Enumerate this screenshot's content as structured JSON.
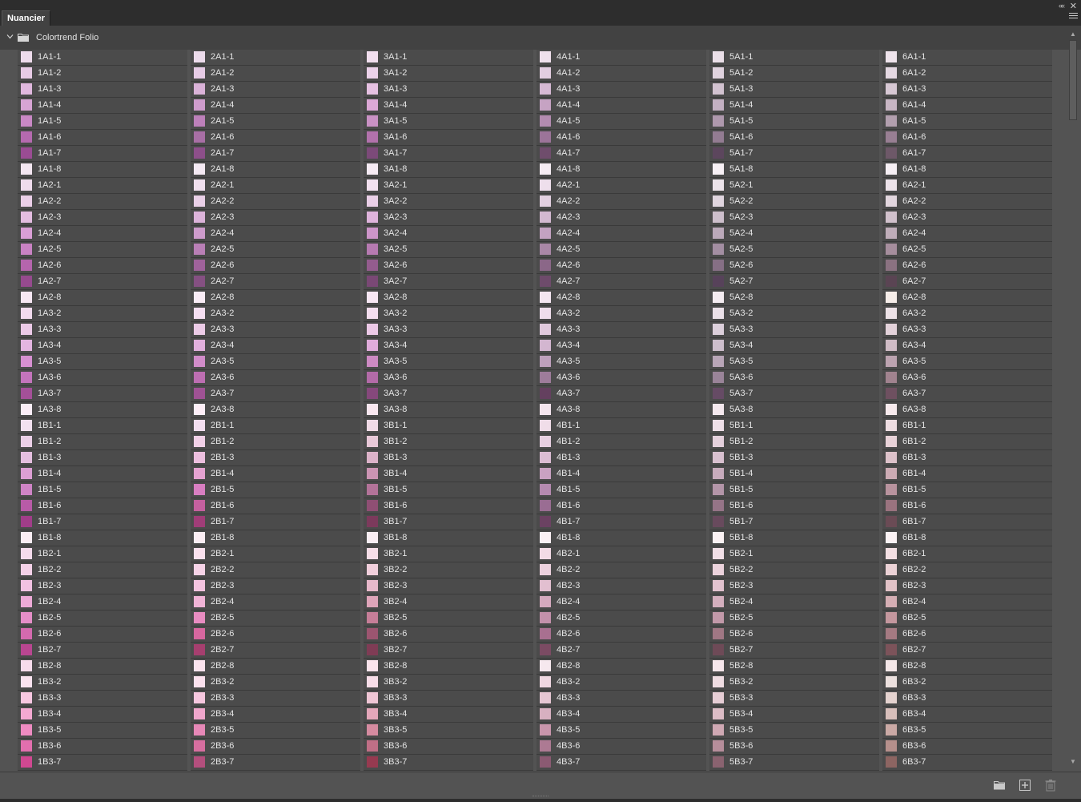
{
  "panel": {
    "tab_label": "Nuancier",
    "collapse_glyph": "««",
    "close_glyph": "✕",
    "menu_icon": "panel-menu-icon"
  },
  "group": {
    "label": "Colortrend Folio",
    "expanded": true,
    "icon": "folder-icon"
  },
  "swatch_labels": [
    [
      "1A1-1",
      "1A1-2",
      "1A1-3",
      "1A1-4",
      "1A1-5",
      "1A1-6",
      "1A1-7",
      "1A1-8",
      "1A2-1",
      "1A2-2",
      "1A2-3",
      "1A2-4",
      "1A2-5",
      "1A2-6",
      "1A2-7",
      "1A2-8",
      "1A3-2",
      "1A3-3",
      "1A3-4",
      "1A3-5",
      "1A3-6",
      "1A3-7",
      "1A3-8",
      "1B1-1",
      "1B1-2",
      "1B1-3",
      "1B1-4",
      "1B1-5",
      "1B1-6",
      "1B1-7",
      "1B1-8",
      "1B2-1",
      "1B2-2",
      "1B2-3",
      "1B2-4",
      "1B2-5",
      "1B2-6",
      "1B2-7",
      "1B2-8",
      "1B3-2",
      "1B3-3",
      "1B3-4",
      "1B3-5",
      "1B3-6",
      "1B3-7"
    ],
    [
      "2A1-1",
      "2A1-2",
      "2A1-3",
      "2A1-4",
      "2A1-5",
      "2A1-6",
      "2A1-7",
      "2A1-8",
      "2A2-1",
      "2A2-2",
      "2A2-3",
      "2A2-4",
      "2A2-5",
      "2A2-6",
      "2A2-7",
      "2A2-8",
      "2A3-2",
      "2A3-3",
      "2A3-4",
      "2A3-5",
      "2A3-6",
      "2A3-7",
      "2A3-8",
      "2B1-1",
      "2B1-2",
      "2B1-3",
      "2B1-4",
      "2B1-5",
      "2B1-6",
      "2B1-7",
      "2B1-8",
      "2B2-1",
      "2B2-2",
      "2B2-3",
      "2B2-4",
      "2B2-5",
      "2B2-6",
      "2B2-7",
      "2B2-8",
      "2B3-2",
      "2B3-3",
      "2B3-4",
      "2B3-5",
      "2B3-6",
      "2B3-7"
    ],
    [
      "3A1-1",
      "3A1-2",
      "3A1-3",
      "3A1-4",
      "3A1-5",
      "3A1-6",
      "3A1-7",
      "3A1-8",
      "3A2-1",
      "3A2-2",
      "3A2-3",
      "3A2-4",
      "3A2-5",
      "3A2-6",
      "3A2-7",
      "3A2-8",
      "3A3-2",
      "3A3-3",
      "3A3-4",
      "3A3-5",
      "3A3-6",
      "3A3-7",
      "3A3-8",
      "3B1-1",
      "3B1-2",
      "3B1-3",
      "3B1-4",
      "3B1-5",
      "3B1-6",
      "3B1-7",
      "3B1-8",
      "3B2-1",
      "3B2-2",
      "3B2-3",
      "3B2-4",
      "3B2-5",
      "3B2-6",
      "3B2-7",
      "3B2-8",
      "3B3-2",
      "3B3-3",
      "3B3-4",
      "3B3-5",
      "3B3-6",
      "3B3-7"
    ],
    [
      "4A1-1",
      "4A1-2",
      "4A1-3",
      "4A1-4",
      "4A1-5",
      "4A1-6",
      "4A1-7",
      "4A1-8",
      "4A2-1",
      "4A2-2",
      "4A2-3",
      "4A2-4",
      "4A2-5",
      "4A2-6",
      "4A2-7",
      "4A2-8",
      "4A3-2",
      "4A3-3",
      "4A3-4",
      "4A3-5",
      "4A3-6",
      "4A3-7",
      "4A3-8",
      "4B1-1",
      "4B1-2",
      "4B1-3",
      "4B1-4",
      "4B1-5",
      "4B1-6",
      "4B1-7",
      "4B1-8",
      "4B2-1",
      "4B2-2",
      "4B2-3",
      "4B2-4",
      "4B2-5",
      "4B2-6",
      "4B2-7",
      "4B2-8",
      "4B3-2",
      "4B3-3",
      "4B3-4",
      "4B3-5",
      "4B3-6",
      "4B3-7"
    ],
    [
      "5A1-1",
      "5A1-2",
      "5A1-3",
      "5A1-4",
      "5A1-5",
      "5A1-6",
      "5A1-7",
      "5A1-8",
      "5A2-1",
      "5A2-2",
      "5A2-3",
      "5A2-4",
      "5A2-5",
      "5A2-6",
      "5A2-7",
      "5A2-8",
      "5A3-2",
      "5A3-3",
      "5A3-4",
      "5A3-5",
      "5A3-6",
      "5A3-7",
      "5A3-8",
      "5B1-1",
      "5B1-2",
      "5B1-3",
      "5B1-4",
      "5B1-5",
      "5B1-6",
      "5B1-7",
      "5B1-8",
      "5B2-1",
      "5B2-2",
      "5B2-3",
      "5B2-4",
      "5B2-5",
      "5B2-6",
      "5B2-7",
      "5B2-8",
      "5B3-2",
      "5B3-3",
      "5B3-4",
      "5B3-5",
      "5B3-6",
      "5B3-7"
    ],
    [
      "6A1-1",
      "6A1-2",
      "6A1-3",
      "6A1-4",
      "6A1-5",
      "6A1-6",
      "6A1-7",
      "6A1-8",
      "6A2-1",
      "6A2-2",
      "6A2-3",
      "6A2-4",
      "6A2-5",
      "6A2-6",
      "6A2-7",
      "6A2-8",
      "6A3-2",
      "6A3-3",
      "6A3-4",
      "6A3-5",
      "6A3-6",
      "6A3-7",
      "6A3-8",
      "6B1-1",
      "6B1-2",
      "6B1-3",
      "6B1-4",
      "6B1-5",
      "6B1-6",
      "6B1-7",
      "6B1-8",
      "6B2-1",
      "6B2-2",
      "6B2-3",
      "6B2-4",
      "6B2-5",
      "6B2-6",
      "6B2-7",
      "6B2-8",
      "6B3-2",
      "6B3-3",
      "6B3-4",
      "6B3-5",
      "6B3-6",
      "6B3-7"
    ]
  ],
  "swatch_colors": [
    [
      "#eedcec",
      "#e8cce6",
      "#e0b8de",
      "#d7a4d4",
      "#c988c5",
      "#b56aaf",
      "#9a4c93",
      "#f3e6f1",
      "#f0dced",
      "#ebcfe8",
      "#e4bde1",
      "#da9fd6",
      "#c982c3",
      "#b565ad",
      "#964a8e",
      "#f7e7f3",
      "#f2dbee",
      "#eccae8",
      "#e4b5e1",
      "#d790d1",
      "#c474bc",
      "#a45098",
      "#fbeef7",
      "#f3e1f0",
      "#ecd0e8",
      "#e5bfe0",
      "#dd9fd4",
      "#cf84c6",
      "#b85ba7",
      "#a13d89",
      "#fbeef4",
      "#f5dced",
      "#f4d1e8",
      "#f2c2e2",
      "#eeaad7",
      "#e58ec8",
      "#d46aae",
      "#b94691",
      "#f8dcec",
      "#fbe3f0",
      "#f8c7e1",
      "#f4a9d2",
      "#ee8bc1",
      "#e26fae",
      "#d04891"
    ],
    [
      "#eddcec",
      "#e6cbe5",
      "#dab2d8",
      "#cf9ccd",
      "#bd80ba",
      "#a86fa5",
      "#8d4f8a",
      "#f4e9f3",
      "#efdeed",
      "#e9cfe7",
      "#dcb3da",
      "#cd9bcb",
      "#b97fb6",
      "#9f629b",
      "#855082",
      "#f9ecf6",
      "#f4def1",
      "#eccbe7",
      "#e1afdc",
      "#d18cc9",
      "#bd6eb2",
      "#9f5294",
      "#fdeef7",
      "#f3def0",
      "#f1d0e7",
      "#edbfdf",
      "#e5a2d1",
      "#d87ec1",
      "#c5609f",
      "#a03d78",
      "#fbeef4",
      "#fae1ee",
      "#f6d3e7",
      "#f4c3df",
      "#f0b3d6",
      "#e88cc1",
      "#d7679f",
      "#a63f6f",
      "#fbe3ee",
      "#fbe1ee",
      "#f6c7df",
      "#f0a6cc",
      "#e688b7",
      "#d66e9f",
      "#b34f7d"
    ],
    [
      "#f2dfef",
      "#ecd2ea",
      "#e6c1e2",
      "#dca8d6",
      "#c991c4",
      "#b272ac",
      "#7c4a79",
      "#f6ebf4",
      "#f3e1f0",
      "#eacfe7",
      "#dfb4dc",
      "#cd95c9",
      "#b67ab1",
      "#945c8e",
      "#7a4875",
      "#f8e7f4",
      "#f4deef",
      "#ecc9e7",
      "#e0acdb",
      "#cd8ac3",
      "#b36ba8",
      "#86487c",
      "#f9e7f0",
      "#f1dbe7",
      "#e8c8d8",
      "#dcb3c9",
      "#cb94b3",
      "#b37399",
      "#8f4f74",
      "#7c3a5c",
      "#f9eef3",
      "#f6dee8",
      "#f1cfdc",
      "#e8b9cb",
      "#dfa5ba",
      "#c67e98",
      "#9c5570",
      "#7f3c55",
      "#fbe4ec",
      "#f7dde8",
      "#efc6d5",
      "#e4a7ba",
      "#d58ba0",
      "#c06f86",
      "#963a50"
    ],
    [
      "#efe0ec",
      "#e2cde0",
      "#d5b8d3",
      "#c6a3c3",
      "#b38bb0",
      "#9c7499",
      "#6f4d6c",
      "#f5ecf3",
      "#eedfec",
      "#e2cfe0",
      "#d3b9d1",
      "#c3a2c1",
      "#a987a6",
      "#8b6788",
      "#6e4b6b",
      "#f4e6f1",
      "#eeddeb",
      "#e0c9dd",
      "#d3b6d0",
      "#bea0bc",
      "#9e7c9b",
      "#64405f",
      "#f4e5ee",
      "#f0dde9",
      "#e7cfe1",
      "#dcbdd4",
      "#c9a2c2",
      "#b58ab0",
      "#9a6d93",
      "#6b4262",
      "#fbf1f5",
      "#f3dbe6",
      "#ecd1de",
      "#e2bfd0",
      "#d5a9be",
      "#c391ab",
      "#a87090",
      "#7b4b63",
      "#f6e8ee",
      "#efd7e1",
      "#e5c6d2",
      "#d7b0c0",
      "#c895ab",
      "#ad7a93",
      "#8b5a72"
    ],
    [
      "#eadfe8",
      "#e0d3df",
      "#d2c2d0",
      "#c3b0c2",
      "#ae98ad",
      "#937c92",
      "#5c465d",
      "#f7f0f5",
      "#ece3ea",
      "#e0d5df",
      "#cdbfcc",
      "#bba9ba",
      "#a38ea2",
      "#866f85",
      "#57425a",
      "#f4ecf1",
      "#eae0e8",
      "#dccfdb",
      "#cdbecc",
      "#b8a5b7",
      "#9a8499",
      "#664b65",
      "#f4e8ee",
      "#eedfe8",
      "#e4d0dc",
      "#d9c1d0",
      "#c7abbc",
      "#b395a8",
      "#957487",
      "#684a5d",
      "#fbf2f4",
      "#f1dfe7",
      "#ebd2dc",
      "#e2c2cf",
      "#d4afbe",
      "#c299a9",
      "#a07784",
      "#6e4a57",
      "#f6e6eb",
      "#efdce2",
      "#e6cdd5",
      "#dcbcc6",
      "#cfa8b3",
      "#b68e9b",
      "#8a6370"
    ],
    [
      "#efe4ec",
      "#e4d8e2",
      "#d7c8d4",
      "#c8b6c4",
      "#b29fae",
      "#987f93",
      "#6d5868",
      "#f6eff4",
      "#ede3ea",
      "#e2d6de",
      "#d1c1cc",
      "#bfadb9",
      "#a68e9d",
      "#8b7281",
      "#5a4453",
      "#f6ede9",
      "#ede2e7",
      "#e3d2da",
      "#d0bcc6",
      "#bca3b0",
      "#a1838f",
      "#6e5060",
      "#f7eaed",
      "#eedde2",
      "#e8d2d8",
      "#ddc2ca",
      "#ccabb4",
      "#b8939e",
      "#9a737f",
      "#6a4b55",
      "#fbf2f4",
      "#f3dfe3",
      "#ebd2d6",
      "#e2c2c7",
      "#d5aeb4",
      "#c4979e",
      "#a57a82",
      "#7c535a",
      "#f4e7e8",
      "#ece0de",
      "#e4d2cf",
      "#d8bfbb",
      "#caa9a5",
      "#b6908c",
      "#8d6562"
    ]
  ],
  "footer": {
    "new_group_icon": "folder-icon",
    "new_swatch_icon": "new-swatch-icon",
    "delete_icon": "trash-icon"
  }
}
